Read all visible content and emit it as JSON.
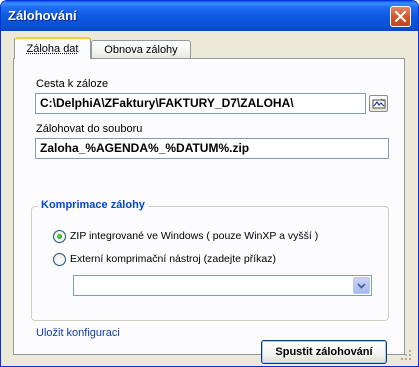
{
  "window": {
    "title": "Zálohování"
  },
  "tabs": [
    {
      "label": "Záloha dat",
      "active": true
    },
    {
      "label": "Obnova zálohy",
      "active": false
    }
  ],
  "backup_path": {
    "label": "Cesta k záloze",
    "value": "C:\\DelphiA\\ZFaktury\\FAKTURY_D7\\ZALOHA\\"
  },
  "backup_file": {
    "label": "Zálohovat do souboru",
    "value": "Zaloha_%AGENDA%_%DATUM%.zip"
  },
  "compression": {
    "title": "Komprimace zálohy",
    "options": [
      {
        "label": "ZIP integrované ve Windows ( pouze WinXP a vyšší )",
        "selected": true
      },
      {
        "label": "Externí komprimační nástroj (zadejte příkaz)",
        "selected": false
      }
    ],
    "external_command": ""
  },
  "save_config_link": "Uložit konfiguraci",
  "start_button": "Spustit zálohování",
  "colors": {
    "titlebar": "#0a4fd4",
    "group_title": "#0046d5",
    "link": "#0b3ea8",
    "close_button": "#d85a33"
  },
  "icons": {
    "close": "close-icon",
    "browse": "browse-folder-icon",
    "dropdown": "chevron-down-icon"
  }
}
